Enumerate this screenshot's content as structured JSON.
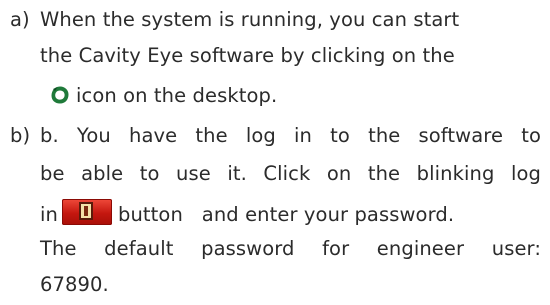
{
  "item_a": {
    "marker": "a)",
    "lines": [
      "When the system is running, you can start",
      "the Cavity Eye software by clicking on the",
      "icon on the desktop."
    ],
    "icon": "cavity-eye-icon"
  },
  "item_b": {
    "marker": "b)",
    "line1": "b.  You have the log in to the software to",
    "line2": "be able to use it. Click on the blinking log",
    "line3_pre": "in",
    "line3_post": "button   and enter your password.",
    "line4": "The default password for engineer user:",
    "line5": "67890.",
    "icon": "login-key-icon"
  },
  "colors": {
    "text": "#2b2b2b",
    "eye_icon": "#1f7a3a",
    "login_button": "#d41f14"
  }
}
